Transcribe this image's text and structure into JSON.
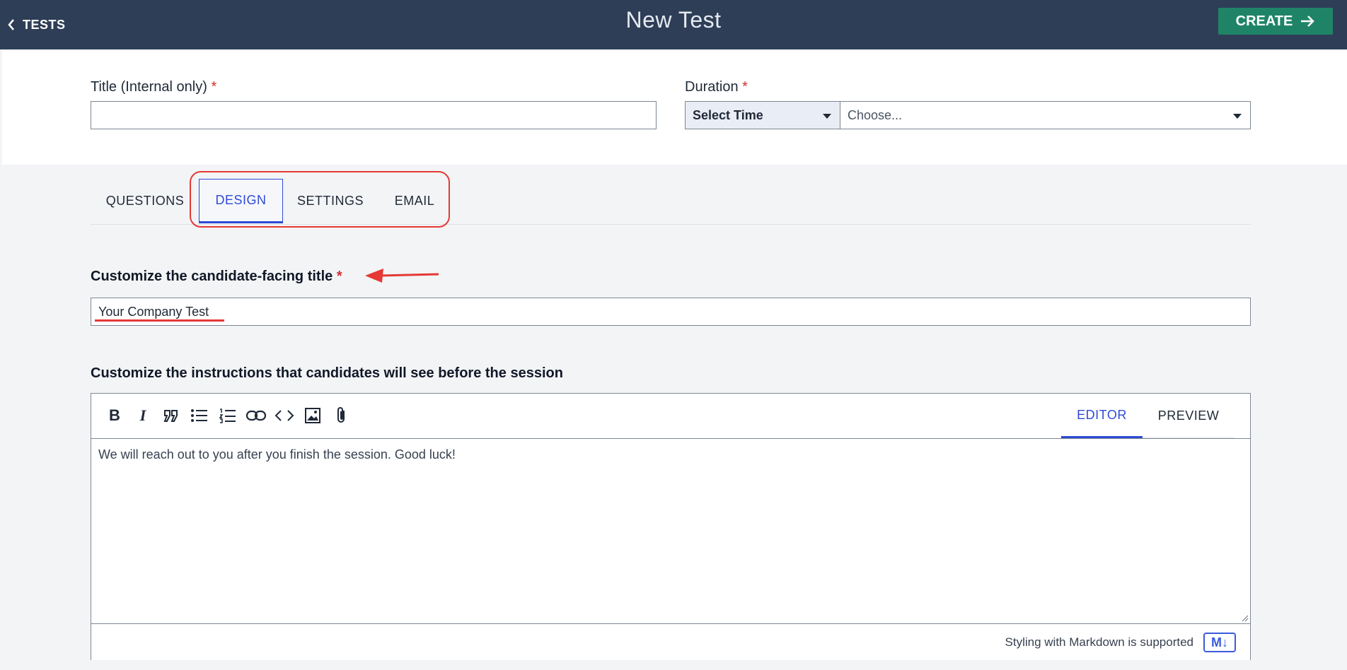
{
  "header": {
    "back_label": "TESTS",
    "title": "New Test",
    "create_label": "CREATE"
  },
  "form": {
    "title_label": "Title (Internal only)",
    "title_required": "*",
    "title_value": "",
    "duration_label": "Duration",
    "duration_required": "*",
    "duration_unit": "Select Time",
    "duration_value": "Choose..."
  },
  "tabs": [
    {
      "label": "QUESTIONS",
      "active": false
    },
    {
      "label": "DESIGN",
      "active": true
    },
    {
      "label": "SETTINGS",
      "active": false
    },
    {
      "label": "EMAIL",
      "active": false
    }
  ],
  "design": {
    "candidate_title_label": "Customize the candidate-facing title",
    "candidate_title_required": "*",
    "candidate_title_value": "Your Company Test",
    "instructions_label": "Customize the instructions that candidates will see before the session",
    "editor_tab": "EDITOR",
    "preview_tab": "PREVIEW",
    "instructions_text": "We will reach out to you after you finish the session. Good luck!",
    "markdown_note": "Styling with Markdown is supported",
    "markdown_badge": "M↓"
  },
  "toolbar_icons": [
    "bold-icon",
    "italic-icon",
    "quote-icon",
    "bullet-list-icon",
    "numbered-list-icon",
    "link-icon",
    "code-icon",
    "image-icon",
    "attachment-icon"
  ],
  "colors": {
    "header_bg": "#2e3e57",
    "create_button": "#1f8467",
    "active_tab": "#2f4bd6",
    "required": "#d32f2f",
    "annotation": "#e53935"
  }
}
